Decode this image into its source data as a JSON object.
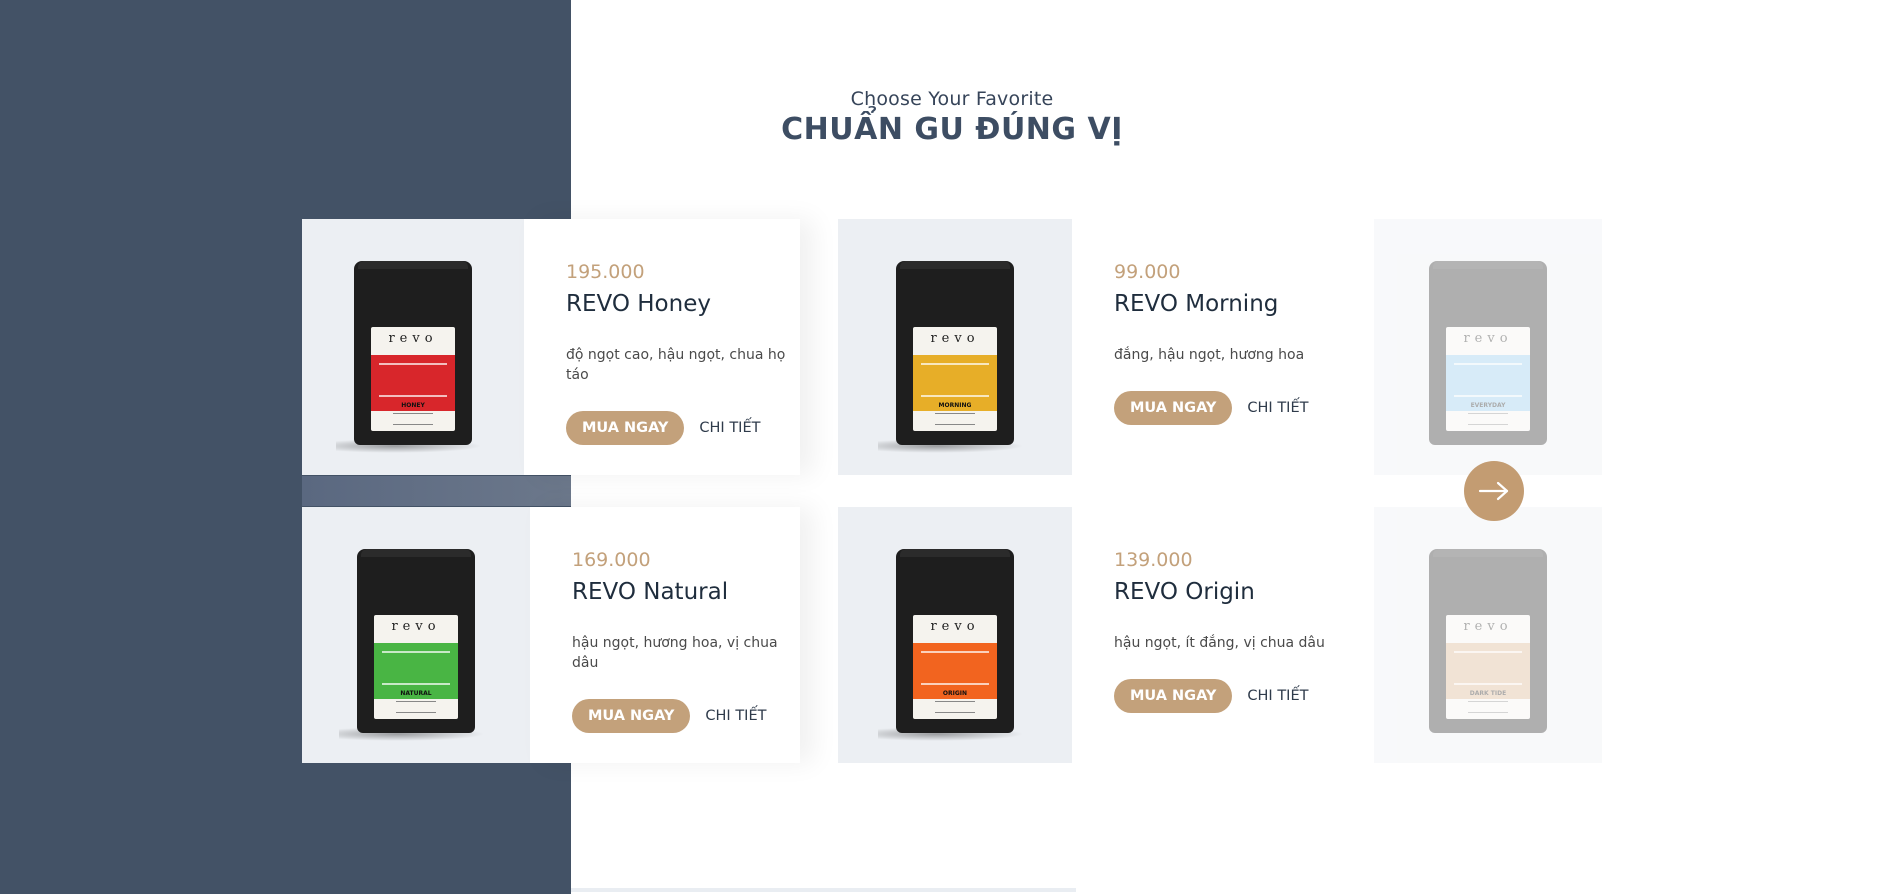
{
  "section": {
    "subtitle": "Choose Your Favorite",
    "title": "CHUẨN GU ĐÚNG VỊ"
  },
  "products": [
    {
      "price": "195.000",
      "name": "REVO Honey",
      "desc": "độ ngọt cao, hậu ngọt, chua họ táo",
      "buy": "MUA NGAY",
      "detail": "CHI TIẾT",
      "label_color": "#d8262b",
      "label_name": "HONEY"
    },
    {
      "price": "99.000",
      "name": "REVO Morning",
      "desc": "đắng, hậu ngọt, hương hoa",
      "buy": "MUA NGAY",
      "detail": "CHI TIẾT",
      "label_color": "#e7ae28",
      "label_name": "MORNING"
    },
    {
      "price": "169.000",
      "name": "REVO Natural",
      "desc": "hậu ngọt, hương hoa, vị chua dâu",
      "buy": "MUA NGAY",
      "detail": "CHI TIẾT",
      "label_color": "#49b544",
      "label_name": "NATURAL"
    },
    {
      "price": "139.000",
      "name": "REVO Origin",
      "desc": "hậu ngọt, ít đắng, vị chua dâu",
      "buy": "MUA NGAY",
      "detail": "CHI TIẾT",
      "label_color": "#f2641f",
      "label_name": "ORIGIN"
    }
  ],
  "faded_products": [
    {
      "label_color": "#8fc8ec",
      "label_name": "EVERYDAY"
    },
    {
      "label_color": "#d9b08a",
      "label_name": "DARK TIDE"
    }
  ],
  "colors": {
    "accent": "#c3a17b",
    "panel": "#435266",
    "title": "#3d4d63"
  },
  "icons": {
    "next": "arrow-right-icon"
  }
}
